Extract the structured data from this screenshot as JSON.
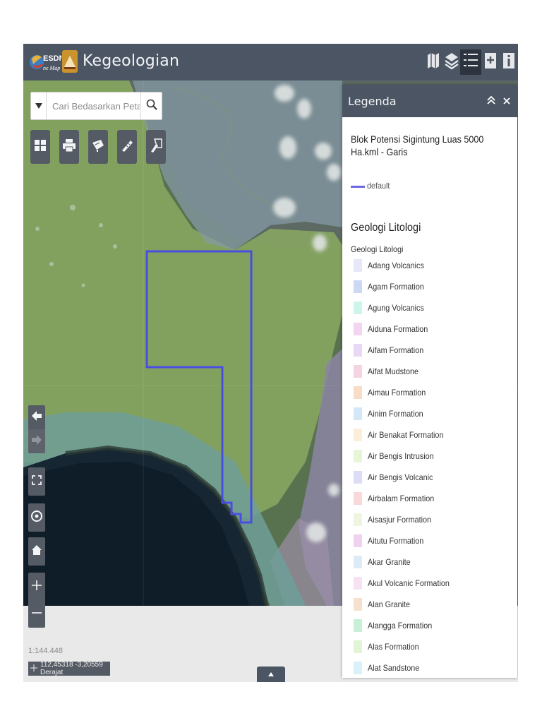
{
  "header": {
    "title": "Kegeologian",
    "logo_text": "ESDM One Map"
  },
  "search": {
    "placeholder": "Cari Bedasarkan Peta"
  },
  "tools": [
    "basemap-icon",
    "print-icon",
    "measure-icon",
    "ruler-icon",
    "draw-icon"
  ],
  "header_buttons": [
    "map-icon",
    "layers-icon",
    "legend-icon",
    "add-data-icon",
    "info-icon"
  ],
  "legend": {
    "title": "Legenda",
    "layer1": {
      "title": "Blok Potensi Sigintung Luas 5000 Ha.kml - Garis",
      "symbol_label": "default",
      "symbol_color": "#6a6ae8"
    },
    "layer2": {
      "title": "Geologi Litologi",
      "subtitle": "Geologi Litologi",
      "items": [
        {
          "name": "Adang Volcanics",
          "color": "#e6e8f8"
        },
        {
          "name": "Agam Formation",
          "color": "#cdd8f4"
        },
        {
          "name": "Agung Volcanics",
          "color": "#cdf5ea"
        },
        {
          "name": "Aiduna Formation",
          "color": "#f2d6f0"
        },
        {
          "name": "Aifam Formation",
          "color": "#e8d8f4"
        },
        {
          "name": "Aifat Mudstone",
          "color": "#f4d4e2"
        },
        {
          "name": "Aimau Formation",
          "color": "#f8dcc8"
        },
        {
          "name": "Ainim Formation",
          "color": "#d2e8f6"
        },
        {
          "name": "Air Benakat Formation",
          "color": "#faf0d8"
        },
        {
          "name": "Air Bengis Intrusion",
          "color": "#e8f6d8"
        },
        {
          "name": "Air Bengis Volcanic",
          "color": "#dcdcf6"
        },
        {
          "name": "Airbalam Formation",
          "color": "#f8d8d8"
        },
        {
          "name": "Aisasjur Formation",
          "color": "#eef6e2"
        },
        {
          "name": "Aitutu Formation",
          "color": "#eed2ee"
        },
        {
          "name": "Akar Granite",
          "color": "#deeaf6"
        },
        {
          "name": "Akul Volcanic Formation",
          "color": "#f6e2f2"
        },
        {
          "name": "Alan Granite",
          "color": "#f6e2cc"
        },
        {
          "name": "Alangga Formation",
          "color": "#c8f0d6"
        },
        {
          "name": "Alas Formation",
          "color": "#e2f4d6"
        },
        {
          "name": "Alat Sandstone",
          "color": "#d8f2f8"
        }
      ]
    }
  },
  "map": {
    "scale": "1:144.448",
    "coordinates": "112,45318 -3,20559 Derajat",
    "boundary_color": "#4a4ee0"
  }
}
